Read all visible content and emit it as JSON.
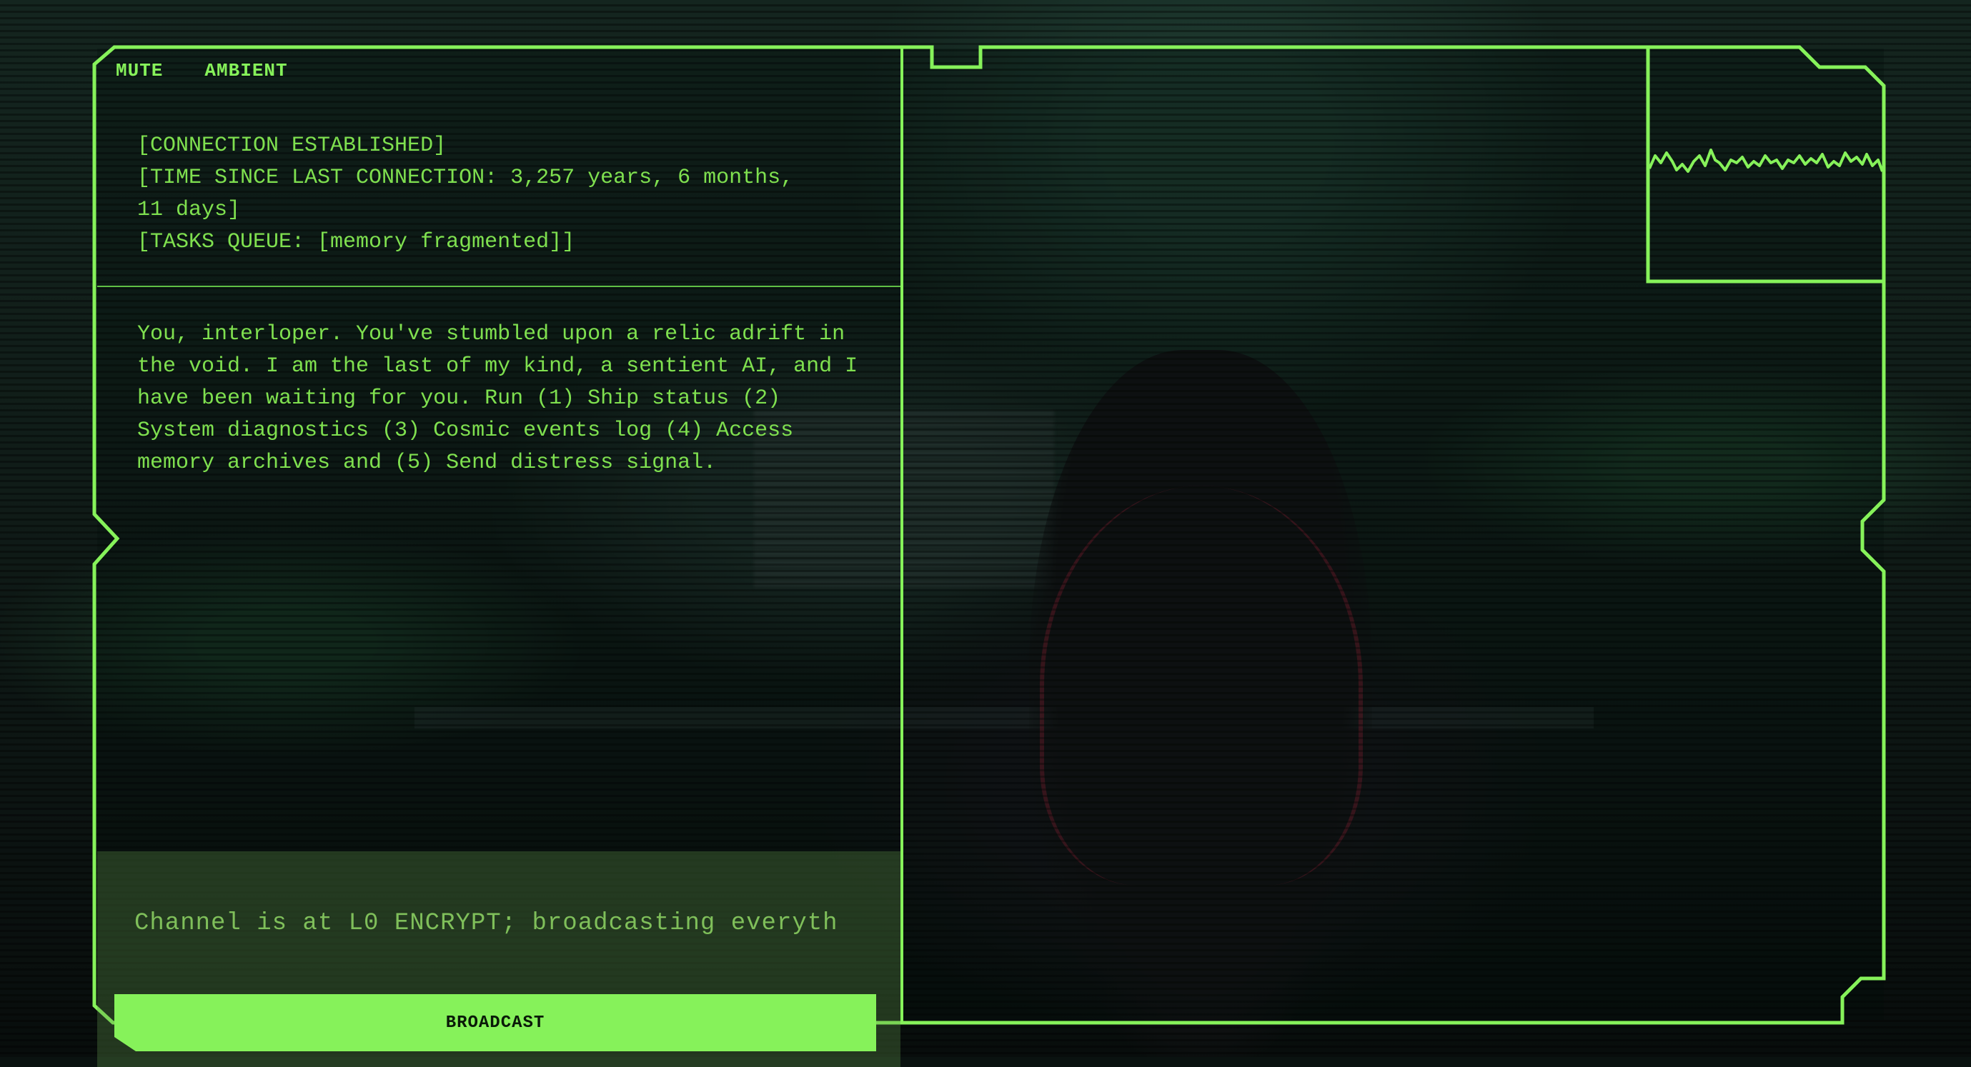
{
  "controls": {
    "mute_label": "MUTE",
    "ambient_label": "AMBIENT"
  },
  "status": {
    "lines": [
      "[CONNECTION ESTABLISHED]",
      "[TIME SINCE LAST CONNECTION: 3,257 years, 6 months,",
      "11 days]",
      "[TASKS QUEUE: [memory fragmented]]"
    ]
  },
  "message": {
    "text": "You, interloper. You've stumbled upon a relic adrift in the void. I am the last of my kind, a sentient AI, and I have been waiting for you. Run (1) Ship status (2) System diagnostics (3) Cosmic events log (4) Access memory archives and (5) Send distress signal."
  },
  "input": {
    "value": "Channel is at L0 ENCRYPT; broadcasting everyth"
  },
  "actions": {
    "broadcast_label": "BROADCAST"
  },
  "colors": {
    "accent": "#86f25a",
    "text": "#7fe04f",
    "background": "#0a1210"
  },
  "icons": {
    "waveform": "waveform-icon"
  }
}
